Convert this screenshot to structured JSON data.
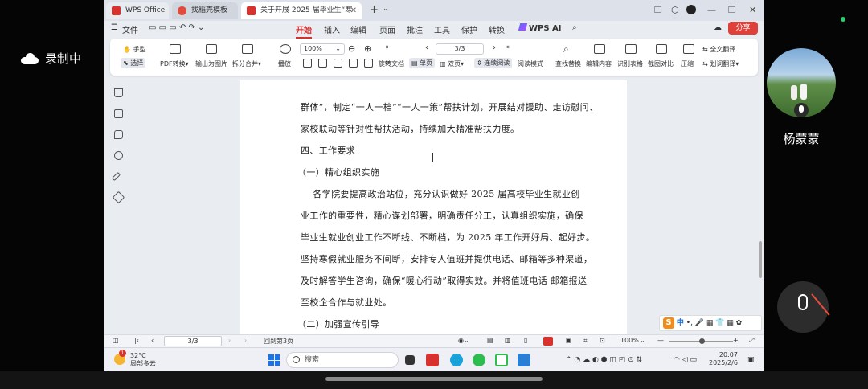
{
  "meeting": {
    "recording_label": "录制中",
    "participant_name": "杨蒙蒙"
  },
  "tabs": [
    {
      "label": "WPS Office"
    },
    {
      "label": "找稻壳模板"
    },
    {
      "label": "关于开展 2025 届毕业生“寒"
    }
  ],
  "menu": {
    "file": "文件",
    "items": [
      "开始",
      "插入",
      "编辑",
      "页面",
      "批注",
      "工具",
      "保护",
      "转换"
    ],
    "active": "开始",
    "wps_ai": "WPS AI",
    "share": "分享"
  },
  "ribbon": {
    "hand": "手型",
    "select": "选择",
    "pdf_convert": "PDF转换",
    "export_image": "输出为图片",
    "split_merge": "拆分合并",
    "play": "播放",
    "zoom": "100%",
    "page": "3/3",
    "rotate": "旋转文档",
    "single_page": "单页",
    "double_page": "双页",
    "continuous": "连续阅读",
    "read_mode": "阅读模式",
    "find_replace": "查找替换",
    "edit_content": "编辑内容",
    "recognize_table": "识别表格",
    "compare": "截图对比",
    "compress": "压缩",
    "full_translate": "全文翻译",
    "word_translate": "划词翻译"
  },
  "document": {
    "lines": [
      "群体”，制定“一人一档”“一人一策”帮扶计划，开展结对援助、走访慰问、",
      "家校联动等针对性帮扶活动，持续加大精准帮扶力度。",
      "四、工作要求",
      "（一）精心组织实施",
      "    各学院要提高政治站位，充分认识做好 2025 届高校毕业生就业创",
      "业工作的重要性，精心谋划部署，明确责任分工，认真组织实施，确保",
      "毕业生就业创业工作不断线、不断档，为 2025 年工作开好局、起好步。",
      "坚持寒假就业服务不间断，安排专人值班并提供电话、邮箱等多种渠道，",
      "及时解答学生咨询，确保“暖心行动”取得实效。并将值班电话 邮箱报送",
      "至校企合作与就业处。",
      "（二）加强宣传引导"
    ]
  },
  "statusbar": {
    "page": "3/3",
    "goto": "回到第3页",
    "zoom": "100%"
  },
  "ime": {
    "label": "中"
  },
  "taskbar": {
    "weather_temp": "32°C",
    "weather_desc": "局部多云",
    "badge": "1",
    "search_placeholder": "搜索",
    "time": "20:07",
    "date": "2025/2/6"
  }
}
